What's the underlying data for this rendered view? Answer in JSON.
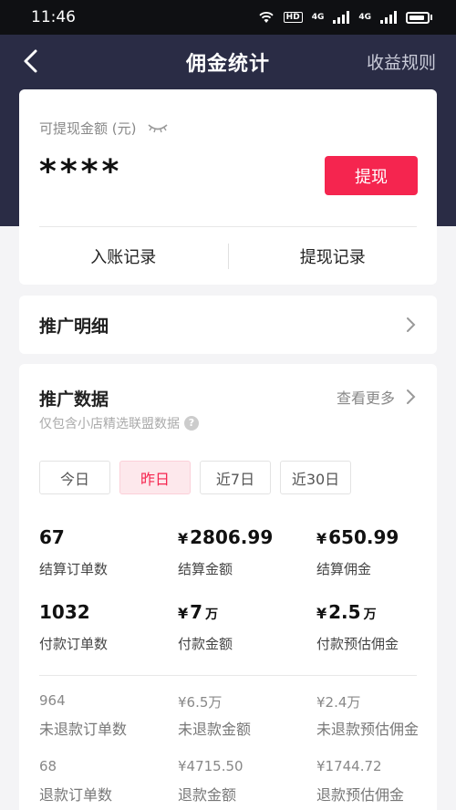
{
  "status": {
    "time": "11:46",
    "hd": "HD",
    "net1": "4G",
    "net2": "4G"
  },
  "nav": {
    "title": "佣金统计",
    "rules": "收益规则"
  },
  "balance": {
    "label": "可提现金额 (元)",
    "value": "****",
    "withdraw_button": "提现",
    "income_records": "入账记录",
    "withdraw_records": "提现记录"
  },
  "promo_detail": {
    "title": "推广明细"
  },
  "stats": {
    "title": "推广数据",
    "more": "查看更多",
    "subtitle": "仅包含小店精选联盟数据",
    "help": "?",
    "tabs": [
      {
        "label": "今日"
      },
      {
        "label": "昨日"
      },
      {
        "label": "近7日"
      },
      {
        "label": "近30日"
      }
    ],
    "active_tab": 1,
    "main": [
      {
        "value": "67",
        "label": "结算订单数"
      },
      {
        "yen": "¥",
        "value": "2806.99",
        "label": "结算金额"
      },
      {
        "yen": "¥",
        "value": "650.99",
        "label": "结算佣金"
      },
      {
        "value": "1032",
        "label": "付款订单数"
      },
      {
        "yen": "¥",
        "value": "7",
        "unit": "万",
        "label": "付款金额"
      },
      {
        "yen": "¥",
        "value": "2.5",
        "unit": "万",
        "label": "付款预估佣金"
      }
    ],
    "secondary": [
      {
        "value": "964",
        "label": "未退款订单数"
      },
      {
        "value": "¥6.5万",
        "label": "未退款金额"
      },
      {
        "value": "¥2.4万",
        "label": "未退款预估佣金"
      },
      {
        "value": "68",
        "label": "退款订单数"
      },
      {
        "value": "¥4715.50",
        "label": "退款金额"
      },
      {
        "value": "¥1744.72",
        "label": "退款预估佣金"
      }
    ]
  },
  "colors": {
    "accent": "#f5254f",
    "header_bg": "#2a2c45",
    "page_bg": "#f4f4f6"
  }
}
